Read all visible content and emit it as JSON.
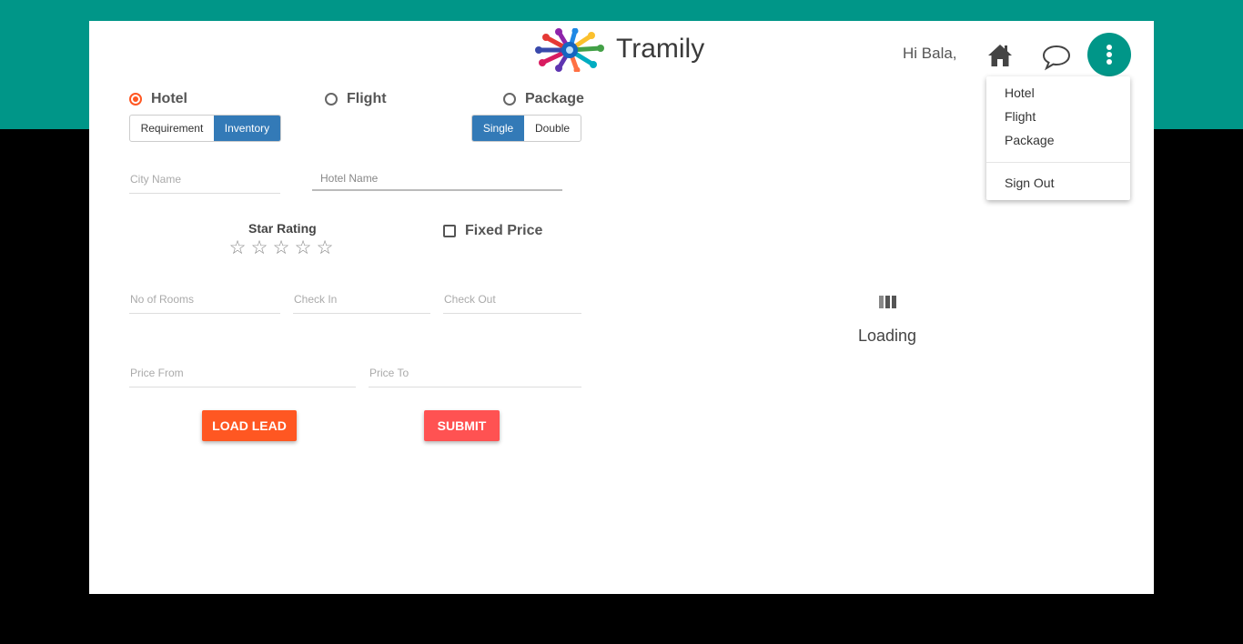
{
  "header": {
    "brand": "Tramily",
    "greeting": "Hi Bala,",
    "icons": {
      "home": "home-icon",
      "chat": "chat-icon",
      "menu": "more-vertical-icon"
    }
  },
  "menu": {
    "items": [
      "Hotel",
      "Flight",
      "Package"
    ],
    "sign_out": "Sign Out"
  },
  "form": {
    "types": [
      {
        "label": "Hotel",
        "selected": true
      },
      {
        "label": "Flight",
        "selected": false
      },
      {
        "label": "Package",
        "selected": false
      }
    ],
    "mode": {
      "requirement": "Requirement",
      "inventory": "Inventory",
      "selected": "Inventory"
    },
    "occupancy": {
      "single": "Single",
      "double": "Double",
      "selected": "Single"
    },
    "city_placeholder": "City Name",
    "hotel_placeholder": "Hotel Name",
    "star_rating_label": "Star Rating",
    "star_rating_value": 0,
    "star_rating_max": 5,
    "fixed_price_label": "Fixed Price",
    "fixed_price_checked": false,
    "rooms_placeholder": "No of Rooms",
    "checkin_placeholder": "Check In",
    "checkout_placeholder": "Check Out",
    "price_from_placeholder": "Price From",
    "price_to_placeholder": "Price To",
    "load_lead_label": "LOAD LEAD",
    "submit_label": "SUBMIT"
  },
  "status": {
    "loading_text": "Loading"
  },
  "colors": {
    "teal": "#009688",
    "accent_orange": "#ff5722",
    "submit_red": "#ff5252",
    "primary_blue": "#337ab7"
  }
}
